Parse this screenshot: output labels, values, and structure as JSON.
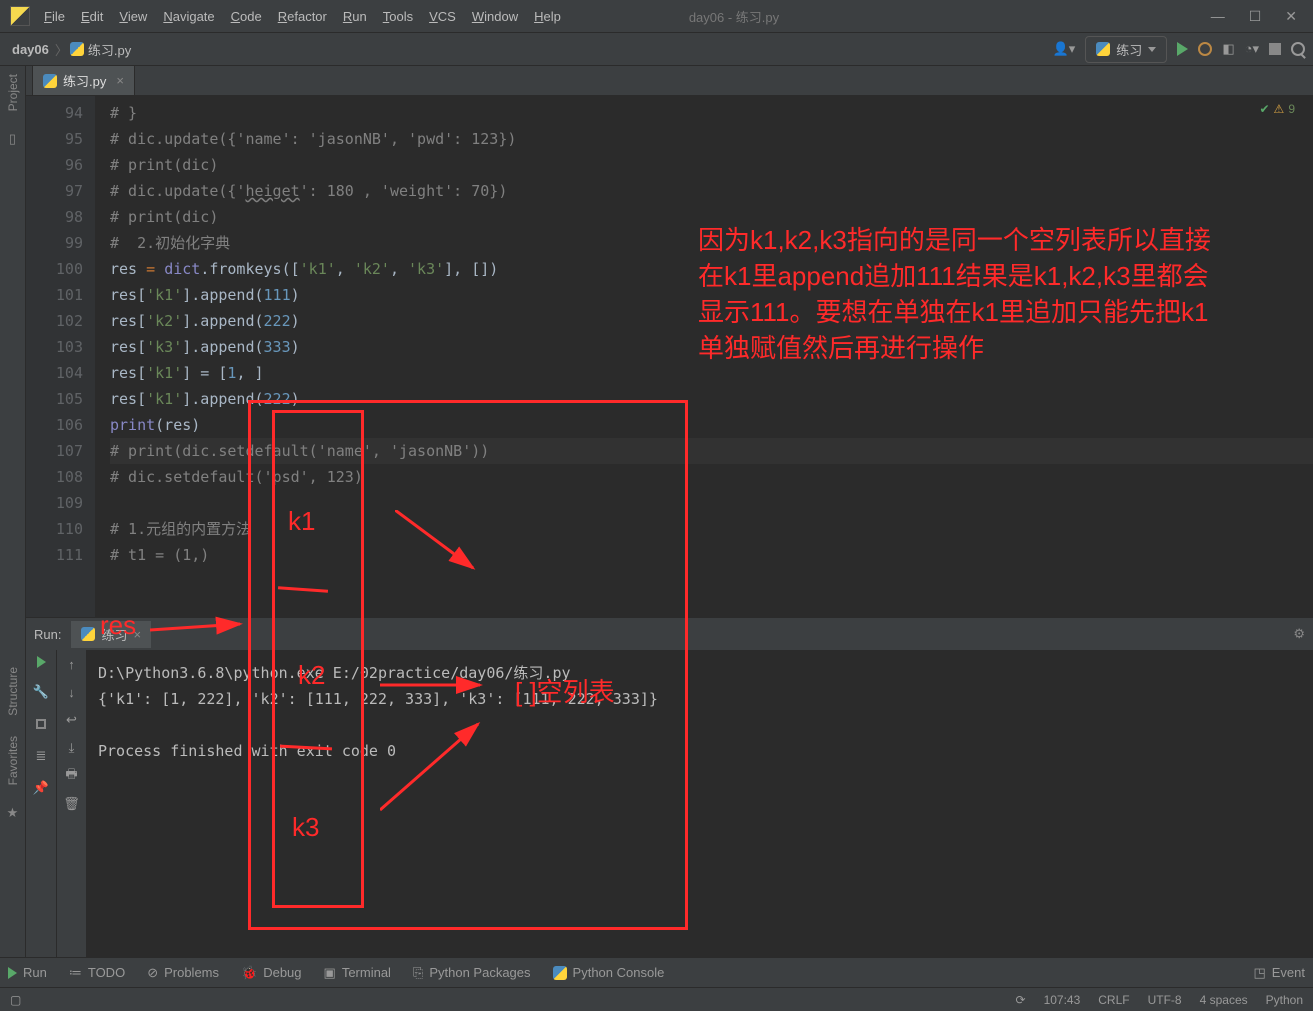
{
  "window": {
    "title": "day06 - 练习.py"
  },
  "menus": [
    "File",
    "Edit",
    "View",
    "Navigate",
    "Code",
    "Refactor",
    "Run",
    "Tools",
    "VCS",
    "Window",
    "Help"
  ],
  "breadcrumb": {
    "project": "day06",
    "file": "练习.py"
  },
  "run_config": "练习",
  "file_tab": "练习.py",
  "side_tabs": {
    "project": "Project",
    "structure": "Structure",
    "favorites": "Favorites"
  },
  "editor": {
    "status_issues": "9",
    "lines": [
      {
        "n": "94",
        "t": "# }",
        "cls": "cmt"
      },
      {
        "n": "95",
        "t": "# dic.update({'name': 'jasonNB', 'pwd': 123})",
        "cls": "cmt"
      },
      {
        "n": "96",
        "t": "# print(dic)",
        "cls": "cmt"
      },
      {
        "n": "97",
        "t": "# dic.update({'heiget': 180 , 'weight': 70})",
        "cls": "cmt typo"
      },
      {
        "n": "98",
        "t": "# print(dic)",
        "cls": "cmt"
      },
      {
        "n": "99",
        "t": "#  2.初始化字典",
        "cls": "cmt"
      },
      {
        "n": "100",
        "tokens": [
          [
            "res ",
            ""
          ],
          [
            "= ",
            "kw"
          ],
          [
            "dict",
            "builtin"
          ],
          [
            ".fromkeys([",
            ""
          ],
          [
            "'k1'",
            "str"
          ],
          [
            ", ",
            ""
          ],
          [
            "'k2'",
            "str"
          ],
          [
            ", ",
            ""
          ],
          [
            "'k3'",
            "str"
          ],
          [
            "], [])",
            ""
          ]
        ]
      },
      {
        "n": "101",
        "tokens": [
          [
            "res[",
            ""
          ],
          [
            "'k1'",
            "str"
          ],
          [
            "].append(",
            ""
          ],
          [
            "111",
            "num"
          ],
          [
            ")",
            ""
          ]
        ]
      },
      {
        "n": "102",
        "tokens": [
          [
            "res[",
            ""
          ],
          [
            "'k2'",
            "str"
          ],
          [
            "].append(",
            ""
          ],
          [
            "222",
            "num"
          ],
          [
            ")",
            ""
          ]
        ]
      },
      {
        "n": "103",
        "tokens": [
          [
            "res[",
            ""
          ],
          [
            "'k3'",
            "str"
          ],
          [
            "].append(",
            ""
          ],
          [
            "333",
            "num"
          ],
          [
            ")",
            ""
          ]
        ]
      },
      {
        "n": "104",
        "tokens": [
          [
            "res[",
            ""
          ],
          [
            "'k1'",
            "str"
          ],
          [
            "] = [",
            ""
          ],
          [
            "1",
            "num"
          ],
          [
            ", ]",
            ""
          ]
        ]
      },
      {
        "n": "105",
        "tokens": [
          [
            "res[",
            ""
          ],
          [
            "'k1'",
            "str"
          ],
          [
            "].append(",
            ""
          ],
          [
            "222",
            "num"
          ],
          [
            ")",
            ""
          ]
        ]
      },
      {
        "n": "106",
        "tokens": [
          [
            "print",
            "builtin"
          ],
          [
            "(res)",
            ""
          ]
        ]
      },
      {
        "n": "107",
        "t": "# print(dic.setdefault('name', 'jasonNB'))",
        "cls": "cmt hl"
      },
      {
        "n": "108",
        "t": "# dic.setdefault('psd', 123)",
        "cls": "cmt"
      },
      {
        "n": "109",
        "t": " ",
        "cls": ""
      },
      {
        "n": "110",
        "t": "# 1.元组的内置方法",
        "cls": "cmt"
      },
      {
        "n": "111",
        "t": "# t1 = (1,)",
        "cls": "cmt"
      }
    ]
  },
  "run_panel": {
    "title": "Run:",
    "tab": "练习",
    "console_lines": [
      "D:\\Python3.6.8\\python.exe E:/02practice/day06/练习.py",
      "{'k1': [1, 222], 'k2': [111, 222, 333], 'k3': [111, 222, 333]}",
      "",
      "Process finished with exit code 0"
    ]
  },
  "bottom_tools": {
    "run": "Run",
    "todo": "TODO",
    "problems": "Problems",
    "debug": "Debug",
    "terminal": "Terminal",
    "pkg": "Python Packages",
    "pyconsole": "Python Console",
    "eventlog": "Event"
  },
  "status": {
    "pos": "107:43",
    "eol": "CRLF",
    "enc": "UTF-8",
    "indent": "4 spaces",
    "lang": "Python"
  },
  "annotations": {
    "main_text": "因为k1,k2,k3指向的是同一个空列表所以直接在k1里append追加111结果是k1,k2,k3里都会显示111。要想在单独在k1里追加只能先把k1单独赋值然后再进行操作",
    "res": "res",
    "k1": "k1",
    "k2": "k2",
    "k3": "k3",
    "empty": "[ ]空列表"
  }
}
